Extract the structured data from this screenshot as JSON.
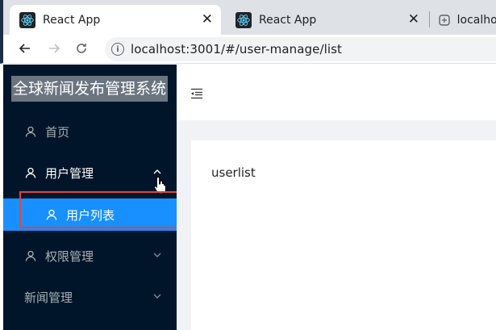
{
  "browser": {
    "tabs": [
      {
        "title": "React App",
        "active": true
      },
      {
        "title": "React App",
        "active": false
      },
      {
        "title": "localhos",
        "active": false
      }
    ],
    "url": "localhost:3001/#/user-manage/list"
  },
  "app": {
    "logo": "全球新闻发布管理系统",
    "menu": {
      "home": "首页",
      "user_manage": "用户管理",
      "user_list": "用户列表",
      "rights_manage": "权限管理",
      "news_manage": "新闻管理"
    },
    "content_text": "userlist"
  },
  "colors": {
    "sider_bg": "#001529",
    "selected_bg": "#1890ff",
    "content_bg": "#f0f2f5",
    "highlight_box": "#e0453f"
  },
  "icons": [
    "react-icon",
    "close-icon",
    "back-icon",
    "forward-icon",
    "reload-icon",
    "info-icon",
    "user-icon",
    "chevron-up-icon",
    "chevron-down-icon",
    "hand-cursor-icon",
    "menu-fold-icon"
  ]
}
